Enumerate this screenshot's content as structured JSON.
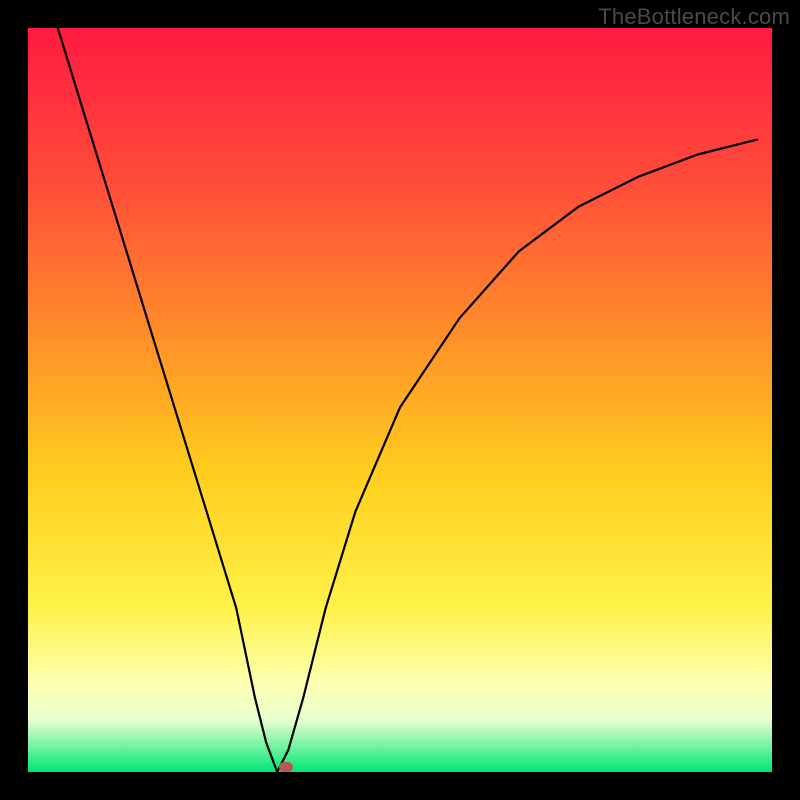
{
  "attribution": "TheBottleneck.com",
  "chart_data": {
    "type": "line",
    "title": "",
    "xlabel": "",
    "ylabel": "",
    "xlim": [
      0,
      1
    ],
    "ylim": [
      0,
      1
    ],
    "legend": false,
    "grid": false,
    "background_gradient": {
      "top": "#ff1a41",
      "mid": "#ffd22a",
      "bottom": "#00e676"
    },
    "optimum_x": 0.335,
    "marker": {
      "x": 0.347,
      "y": 0.007,
      "color": "#b55a52"
    },
    "series": [
      {
        "name": "bottleneck-curve",
        "color": "#000000",
        "x": [
          0.04,
          0.08,
          0.12,
          0.16,
          0.2,
          0.24,
          0.28,
          0.305,
          0.32,
          0.335,
          0.35,
          0.37,
          0.4,
          0.44,
          0.5,
          0.58,
          0.66,
          0.74,
          0.82,
          0.9,
          0.98
        ],
        "values": [
          1.0,
          0.87,
          0.74,
          0.61,
          0.48,
          0.35,
          0.22,
          0.1,
          0.04,
          0.0,
          0.03,
          0.1,
          0.22,
          0.35,
          0.49,
          0.61,
          0.7,
          0.76,
          0.8,
          0.83,
          0.85
        ]
      }
    ]
  }
}
